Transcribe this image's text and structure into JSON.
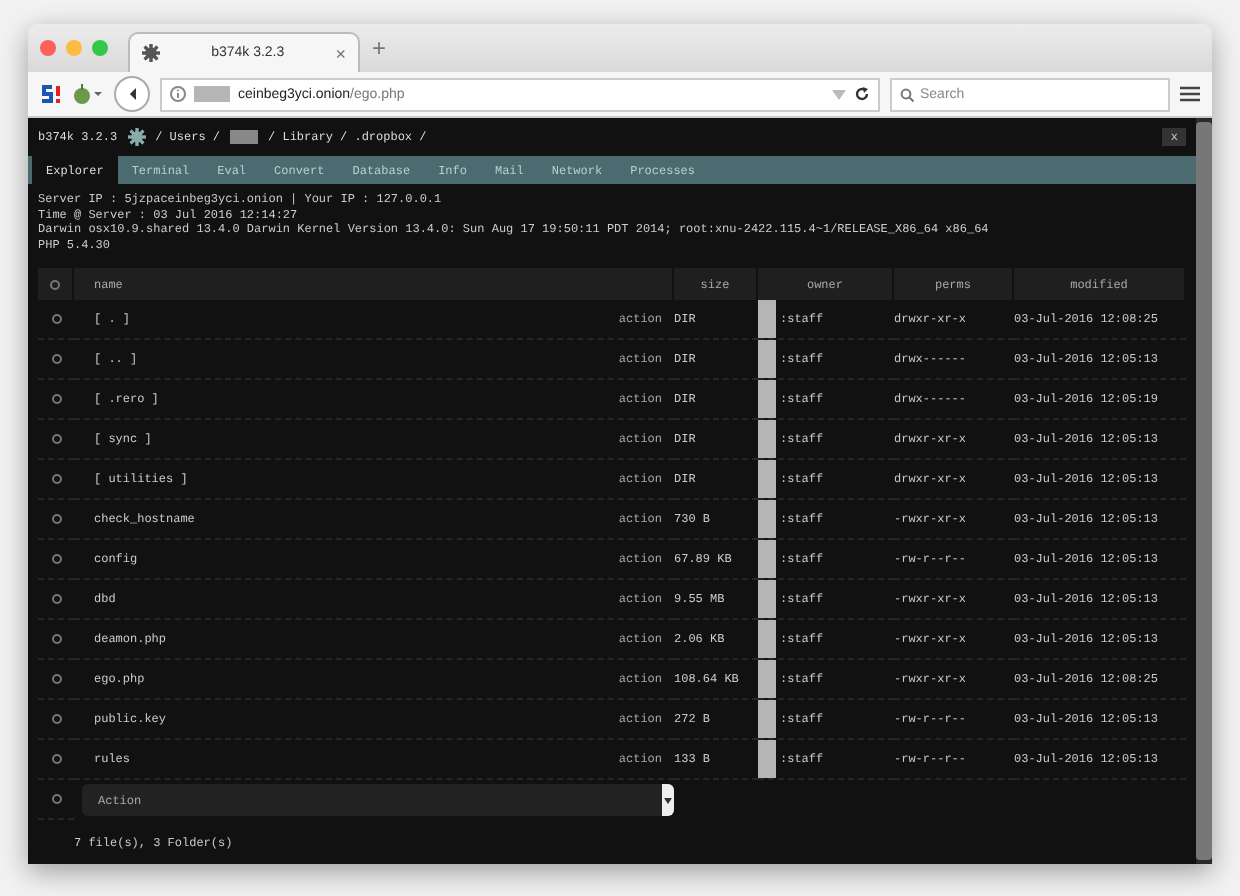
{
  "browser": {
    "tab_title": "b374k 3.2.3",
    "tab_close": "×",
    "new_tab": "+",
    "url_host": "ceinbeg3yci.onion",
    "url_path": "/ego.php",
    "search_placeholder": "Search"
  },
  "header": {
    "app_name": "b374k 3.2.3",
    "path": [
      "/ Users /",
      "/ Library / .dropbox /"
    ],
    "close": "x"
  },
  "tabs": [
    {
      "label": "Explorer",
      "selected": true
    },
    {
      "label": "Terminal",
      "selected": false
    },
    {
      "label": "Eval",
      "selected": false
    },
    {
      "label": "Convert",
      "selected": false
    },
    {
      "label": "Database",
      "selected": false
    },
    {
      "label": "Info",
      "selected": false
    },
    {
      "label": "Mail",
      "selected": false
    },
    {
      "label": "Network",
      "selected": false
    },
    {
      "label": "Processes",
      "selected": false
    }
  ],
  "info": [
    "Server IP : 5jzpaceinbeg3yci.onion | Your IP : 127.0.0.1",
    "Time @ Server : 03 Jul 2016 12:14:27",
    "Darwin osx10.9.shared 13.4.0 Darwin Kernel Version 13.4.0: Sun Aug 17 19:50:11 PDT 2014; root:xnu-2422.115.4~1/RELEASE_X86_64 x86_64",
    "PHP 5.4.30"
  ],
  "table": {
    "columns": [
      "name",
      "size",
      "owner",
      "perms",
      "modified"
    ],
    "select_all_checked": false,
    "action_row_checked": false,
    "rows": [
      {
        "name": "[ . ]",
        "action": "action",
        "size": "DIR",
        "owner": ":staff",
        "perms": "drwxr-xr-x",
        "modified": "03-Jul-2016 12:08:25",
        "checked": false
      },
      {
        "name": "[ .. ]",
        "action": "action",
        "size": "DIR",
        "owner": ":staff",
        "perms": "drwx------",
        "modified": "03-Jul-2016 12:05:13",
        "checked": false
      },
      {
        "name": "[ .rero ]",
        "action": "action",
        "size": "DIR",
        "owner": ":staff",
        "perms": "drwx------",
        "modified": "03-Jul-2016 12:05:19",
        "checked": false
      },
      {
        "name": "[ sync ]",
        "action": "action",
        "size": "DIR",
        "owner": ":staff",
        "perms": "drwxr-xr-x",
        "modified": "03-Jul-2016 12:05:13",
        "checked": false
      },
      {
        "name": "[ utilities ]",
        "action": "action",
        "size": "DIR",
        "owner": ":staff",
        "perms": "drwxr-xr-x",
        "modified": "03-Jul-2016 12:05:13",
        "checked": false
      },
      {
        "name": "check_hostname",
        "action": "action",
        "size": "730 B",
        "owner": ":staff",
        "perms": "-rwxr-xr-x",
        "modified": "03-Jul-2016 12:05:13",
        "checked": false
      },
      {
        "name": "config",
        "action": "action",
        "size": "67.89 KB",
        "owner": ":staff",
        "perms": "-rw-r--r--",
        "modified": "03-Jul-2016 12:05:13",
        "checked": false
      },
      {
        "name": "dbd",
        "action": "action",
        "size": "9.55 MB",
        "owner": ":staff",
        "perms": "-rwxr-xr-x",
        "modified": "03-Jul-2016 12:05:13",
        "checked": false
      },
      {
        "name": "deamon.php",
        "action": "action",
        "size": "2.06 KB",
        "owner": ":staff",
        "perms": "-rwxr-xr-x",
        "modified": "03-Jul-2016 12:05:13",
        "checked": false
      },
      {
        "name": "ego.php",
        "action": "action",
        "size": "108.64 KB",
        "owner": ":staff",
        "perms": "-rwxr-xr-x",
        "modified": "03-Jul-2016 12:08:25",
        "checked": false
      },
      {
        "name": "public.key",
        "action": "action",
        "size": "272 B",
        "owner": ":staff",
        "perms": "-rw-r--r--",
        "modified": "03-Jul-2016 12:05:13",
        "checked": false
      },
      {
        "name": "rules",
        "action": "action",
        "size": "133 B",
        "owner": ":staff",
        "perms": "-rw-r--r--",
        "modified": "03-Jul-2016 12:05:13",
        "checked": false
      }
    ],
    "action_select": "Action",
    "summary": "7 file(s), 3 Folder(s)"
  }
}
